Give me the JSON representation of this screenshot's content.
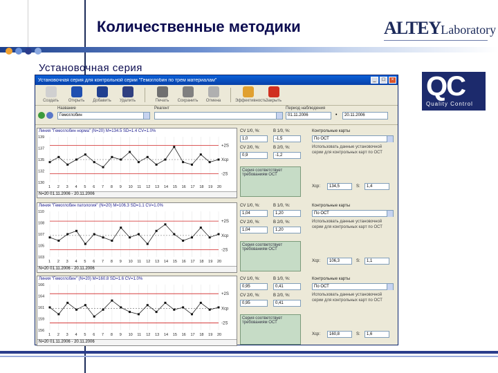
{
  "slide": {
    "title": "Количественные методики",
    "subtitle": "Установочная серия",
    "brand_main": "ALTEY",
    "brand_sub": "Laboratory",
    "qc_logo": {
      "letters": "QC",
      "caption": "Quality Control"
    },
    "accent_color": "#0c0c50",
    "bar_color": "#2a3c8c"
  },
  "window": {
    "title": "Установочная серия для контрольной серии \"Гемоглобин по трем материалам\"",
    "toolbar": [
      {
        "label": "Создать",
        "icon": "new-icon"
      },
      {
        "label": "Открыть",
        "icon": "open-icon"
      },
      {
        "label": "Добавить",
        "icon": "add-icon"
      },
      {
        "label": "Удалить",
        "icon": "delete-icon"
      },
      {
        "label": "Печать",
        "icon": "print-icon"
      },
      {
        "label": "Сохранить",
        "icon": "save-icon"
      },
      {
        "label": "Отмена",
        "icon": "cancel-icon"
      },
      {
        "label": "Эффективность",
        "icon": "chart-icon"
      },
      {
        "label": "Закрыть",
        "icon": "close-icon"
      }
    ],
    "filters": {
      "name_label": "Название",
      "name_value": "Гемоглобин",
      "reagent_label": "Реагент",
      "reagent_value": "",
      "period_label": "Период наблюдения",
      "period_from": "01.11.2006",
      "period_to": "20.11.2006"
    }
  },
  "panels": [
    {
      "header": "Линия \"Гемоглобин норма\" (N=20) M=134.5 SD=1.4 CV=1.0%",
      "footer": "N=20  01.11.2006 - 20.11.2006",
      "cv10_label": "CV 1/0, %:",
      "cv10_value": "1,0",
      "b10_label": "B 1/0, %:",
      "b10_value": "-1,5",
      "cv20_label": "CV 2/0, %:",
      "cv20_value": "0,9",
      "b20_label": "B 2/0, %:",
      "b20_value": "-1,2",
      "status": "Серия соответствует требованиям ОСТ",
      "rules_label": "Контрольные карты",
      "rules_value": "По ОСТ",
      "rules_desc": "Использовать данные установочной серии для контрольных карт по ОСТ",
      "xcp_label": "Хср:",
      "xcp_value": "134,5",
      "s_label": "S:",
      "s_value": "1,4"
    },
    {
      "header": "Линия \"Гемоглобин патология\" (N=20) M=106.3 SD=1.1 CV=1.0%",
      "footer": "N=20  01.11.2006 - 20.11.2006",
      "cv10_label": "CV 1/0, %:",
      "cv10_value": "1,04",
      "b10_label": "B 1/0, %:",
      "b10_value": "1,20",
      "cv20_label": "CV 2/0, %:",
      "cv20_value": "1,04",
      "b20_label": "B 2/0, %:",
      "b20_value": "1,20",
      "status": "Серия соответствует требованиям ОСТ",
      "rules_label": "Контрольные карты",
      "rules_value": "По ОСТ",
      "rules_desc": "Использовать данные установочной серии для контрольных карт по ОСТ",
      "xcp_label": "Хср:",
      "xcp_value": "106,3",
      "s_label": "S:",
      "s_value": "1,1"
    },
    {
      "header": "Линия \"Гемоглобин\" (N=20) M=160.8 SD=1.6 CV=1.0%",
      "footer": "N=20  01.11.2006 - 20.11.2006",
      "cv10_label": "CV 1/0, %:",
      "cv10_value": "0,95",
      "b10_label": "B 1/0, %:",
      "b10_value": "0,41",
      "cv20_label": "CV 2/0, %:",
      "cv20_value": "0,95",
      "b20_label": "B 2/0, %:",
      "b20_value": "0,41",
      "status": "Серия соответствует требованиям ОСТ",
      "rules_label": "Контрольные карты",
      "rules_value": "По ОСТ",
      "rules_desc": "Использовать данные установочной серии для контрольных карт по ОСТ",
      "xcp_label": "Хср:",
      "xcp_value": "160,8",
      "s_label": "S:",
      "s_value": "1,6"
    }
  ],
  "chart_data": [
    {
      "type": "line",
      "title": "",
      "x": [
        1,
        2,
        3,
        4,
        5,
        6,
        7,
        8,
        9,
        10,
        11,
        12,
        13,
        14,
        15,
        16,
        17,
        18,
        19,
        20
      ],
      "series": [
        {
          "values": [
            134.0,
            135.0,
            133.5,
            134.5,
            135.5,
            134.0,
            133.0,
            135.0,
            134.5,
            136.0,
            134.0,
            135.0,
            133.5,
            134.5,
            137.0,
            134.0,
            133.5,
            135.5,
            134.0,
            134.5
          ]
        }
      ],
      "center": 134.5,
      "ucl": 137.3,
      "lcl": 131.7,
      "ylim": [
        130,
        139
      ],
      "right_labels": [
        "+2S",
        "Хср",
        "-2S"
      ]
    },
    {
      "type": "line",
      "title": "",
      "x": [
        1,
        2,
        3,
        4,
        5,
        6,
        7,
        8,
        9,
        10,
        11,
        12,
        13,
        14,
        15,
        16,
        17,
        18,
        19,
        20
      ],
      "series": [
        {
          "values": [
            106.0,
            105.5,
            106.5,
            107.0,
            105.0,
            106.5,
            106.0,
            105.5,
            107.5,
            106.0,
            106.5,
            105.0,
            107.0,
            108.0,
            106.5,
            105.5,
            106.0,
            107.5,
            106.0,
            106.5
          ]
        }
      ],
      "center": 106.3,
      "ucl": 108.5,
      "lcl": 104.1,
      "ylim": [
        103,
        110
      ],
      "right_labels": [
        "+2S",
        "Хср",
        "-2S"
      ]
    },
    {
      "type": "line",
      "title": "",
      "x": [
        1,
        2,
        3,
        4,
        5,
        6,
        7,
        8,
        9,
        10,
        11,
        12,
        13,
        14,
        15,
        16,
        17,
        18,
        19,
        20
      ],
      "series": [
        {
          "values": [
            161.0,
            159.5,
            162.0,
            160.5,
            161.5,
            159.0,
            160.5,
            162.5,
            161.0,
            160.0,
            159.5,
            161.5,
            160.0,
            162.0,
            160.5,
            161.0,
            159.5,
            162.0,
            160.5,
            161.0
          ]
        }
      ],
      "center": 160.8,
      "ucl": 164.0,
      "lcl": 157.6,
      "ylim": [
        156,
        166
      ],
      "right_labels": [
        "+2S",
        "Хср",
        "-2S"
      ]
    }
  ]
}
